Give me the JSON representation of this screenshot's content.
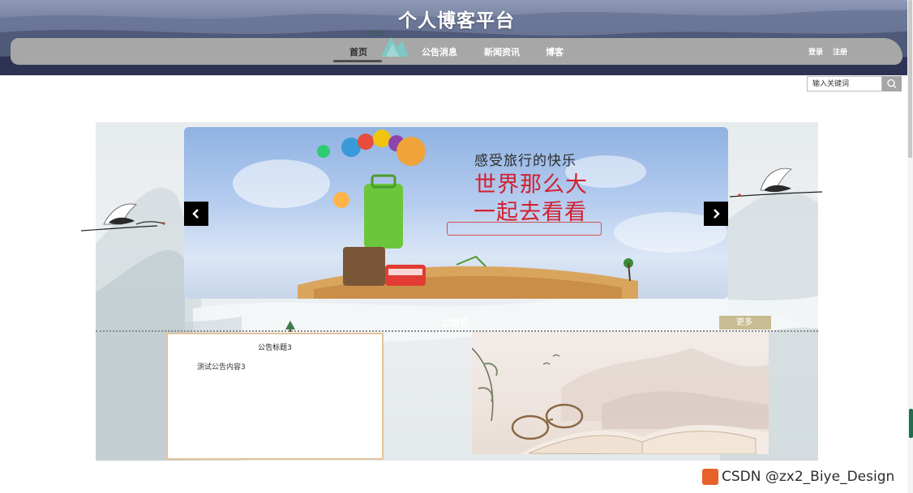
{
  "header": {
    "site_title": "个人博客平台",
    "nav": [
      {
        "label": "首页",
        "active": true
      },
      {
        "label": "公告消息",
        "active": false
      },
      {
        "label": "新闻资讯",
        "active": false
      },
      {
        "label": "博客",
        "active": false
      }
    ],
    "login_label": "登录",
    "register_label": "注册"
  },
  "search": {
    "placeholder": "输入关键词",
    "icon": "search-icon"
  },
  "banner": {
    "line1": "感受旅行的快乐",
    "line2": "世界那么大",
    "line3": "一起去看看",
    "prev_icon": "chevron-left-icon",
    "next_icon": "chevron-right-icon"
  },
  "notice_section": {
    "heading": "公告栏",
    "more_label": "更多",
    "card": {
      "title": "公告标题3",
      "content": "测试公告内容3"
    }
  },
  "watermark": {
    "text": "CSDN @zx2_Biye_Design"
  },
  "colors": {
    "accent_red": "#d2202f",
    "nav_bar": "#a7a7a7",
    "more_button": "#c8bd92",
    "card_border": "#e2c39c"
  }
}
